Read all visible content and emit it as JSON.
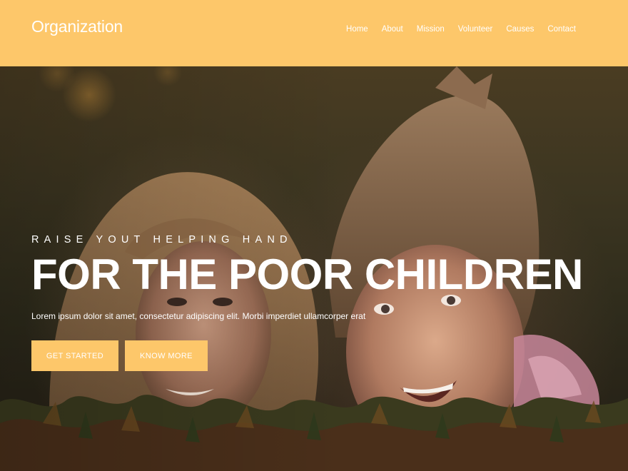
{
  "header": {
    "brand": "Organization",
    "nav": [
      "Home",
      "About",
      "Mission",
      "Volunteer",
      "Causes",
      "Contact"
    ]
  },
  "hero": {
    "tagline": "RAISE YOUT HELPING HAND",
    "headline": "FOR THE POOR CHILDREN",
    "lede": "Lorem ipsum dolor sit amet, consectetur adipiscing elit. Morbi imperdiet ullamcorper erat",
    "buttons": {
      "primary": "GET STARTED",
      "secondary": "KNOW MORE"
    }
  },
  "colors": {
    "accent": "#fdc76a",
    "text_on_accent": "#ffffff"
  }
}
